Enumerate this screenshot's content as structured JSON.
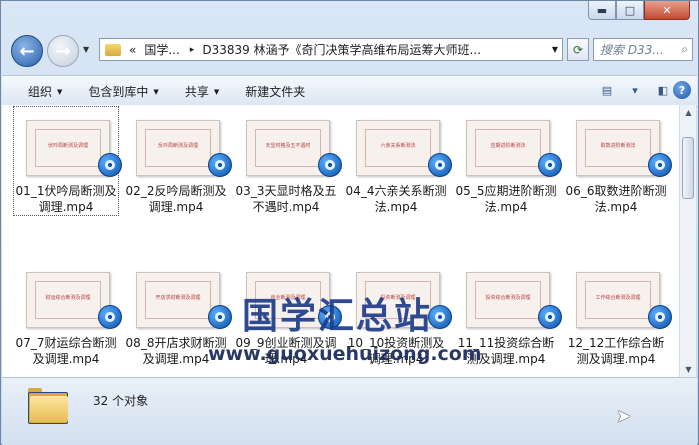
{
  "window": {
    "minimize_glyph": "▬",
    "maximize_glyph": "□",
    "close_glyph": "✕"
  },
  "navigation": {
    "address_prefix": "«",
    "crumb_1": "国学...",
    "crumb_separator": "▸",
    "crumb_2": "D33839 林涵予《奇门决策学高维布局运筹大师班...",
    "search_placeholder": "搜索 D33..."
  },
  "toolbar": {
    "organize": "组织",
    "include_in_library": "包含到库中",
    "share": "共享",
    "new_folder": "新建文件夹",
    "dropdown_glyph": "▼"
  },
  "files": [
    {
      "name": "01_1伏吟局断测及调理.mp4",
      "thumb_text": "伏吟局断测及调理"
    },
    {
      "name": "02_2反吟局断测及调理.mp4",
      "thumb_text": "反吟局断测及调理"
    },
    {
      "name": "03_3天显时格及五不遇时.mp4",
      "thumb_text": "天显时格及五不遇时"
    },
    {
      "name": "04_4六亲关系断测法.mp4",
      "thumb_text": "六亲关系断测法"
    },
    {
      "name": "05_5应期进阶断测法.mp4",
      "thumb_text": "应期进阶断测法"
    },
    {
      "name": "06_6取数进阶断测法.mp4",
      "thumb_text": "取数进阶断测法"
    },
    {
      "name": "07_7财运综合断测及调理.mp4",
      "thumb_text": "财运综合断测及调理"
    },
    {
      "name": "08_8开店求财断测及调理.mp4",
      "thumb_text": "开店求财断测及调理"
    },
    {
      "name": "09_9创业断测及调理.mp4",
      "thumb_text": "创业断测及调理"
    },
    {
      "name": "10_10投资断测及调理.mp4",
      "thumb_text": "投资断测及调理"
    },
    {
      "name": "11_11投资综合断测及调理.mp4",
      "thumb_text": "投资综合断测及调理"
    },
    {
      "name": "12_12工作综合断测及调理.mp4",
      "thumb_text": "工作综合断测及调理"
    }
  ],
  "watermark": {
    "line1": "国学汇总站",
    "line2": "www.guoxuehuizong.com"
  },
  "status": {
    "item_count": "32 个对象"
  },
  "colors": {
    "accent": "#2a5fa8",
    "watermark": "#1f3c8a"
  }
}
